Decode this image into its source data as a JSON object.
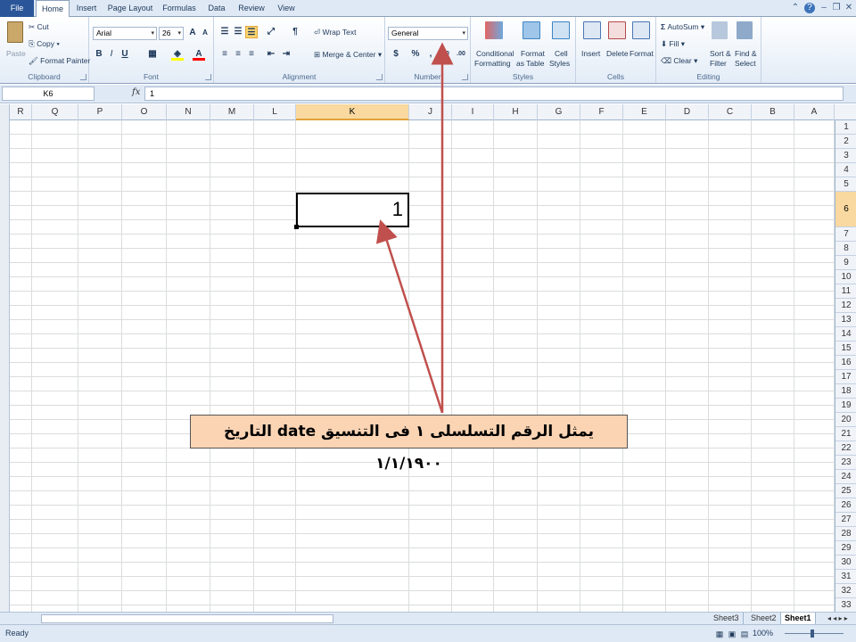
{
  "tabs": [
    "File",
    "Home",
    "Insert",
    "Page Layout",
    "Formulas",
    "Data",
    "Review",
    "View"
  ],
  "clipboard": {
    "paste": "Paste",
    "cut": "Cut",
    "copy": "Copy",
    "format_painter": "Format Painter",
    "label": "Clipboard"
  },
  "font": {
    "name": "Arial",
    "size": "26",
    "bold": "B",
    "italic": "I",
    "underline": "U",
    "grow": "A",
    "shrink": "A",
    "color_letter": "A",
    "label": "Font"
  },
  "alignment": {
    "wrap_text": "Wrap Text",
    "merge_center": "Merge & Center",
    "label": "Alignment"
  },
  "number": {
    "format": "General",
    "percent": "%",
    "comma": ",",
    "label": "Number"
  },
  "styles": {
    "conditional": "Conditional",
    "conditional2": "Formatting",
    "format_as": "Format",
    "format_as2": "as Table",
    "cell": "Cell",
    "cell2": "Styles",
    "label": "Styles"
  },
  "cells_group": {
    "insert": "Insert",
    "delete": "Delete",
    "format": "Format",
    "label": "Cells"
  },
  "editing": {
    "autosum": "AutoSum",
    "fill": "Fill",
    "clear": "Clear",
    "sort": "Sort &",
    "sort2": "Filter",
    "find": "Find &",
    "find2": "Select",
    "label": "Editing"
  },
  "formula_bar": {
    "name_box": "K6",
    "fx": "fx",
    "value": "1"
  },
  "columns": [
    "R",
    "Q",
    "P",
    "O",
    "N",
    "M",
    "L",
    "K",
    "J",
    "I",
    "H",
    "G",
    "F",
    "E",
    "D",
    "C",
    "B",
    "A"
  ],
  "selected_column": "K",
  "rows": [
    "1",
    "2",
    "3",
    "4",
    "5",
    "6",
    "7",
    "8",
    "9",
    "10",
    "11",
    "12",
    "13",
    "14",
    "15",
    "16",
    "17",
    "18",
    "19",
    "20",
    "21",
    "22",
    "23",
    "24",
    "25",
    "26",
    "27",
    "28",
    "29",
    "30",
    "31",
    "32",
    "33"
  ],
  "selected_row": "6",
  "active_cell": {
    "ref": "K6",
    "value": "1"
  },
  "annotation": "يمثل الرقم التسلسلى ١  فى التنسيق date التاريخ ١/١/١٩٠٠",
  "sheets": [
    "Sheet3",
    "Sheet2",
    "Sheet1"
  ],
  "active_sheet": "Sheet1",
  "status": {
    "ready": "Ready",
    "zoom": "100%"
  },
  "colors": {
    "arrow": "#c0504d",
    "note_bg": "#fbd4b4",
    "file_tab": "#2a5699",
    "selected_header": "#f9d99f"
  }
}
